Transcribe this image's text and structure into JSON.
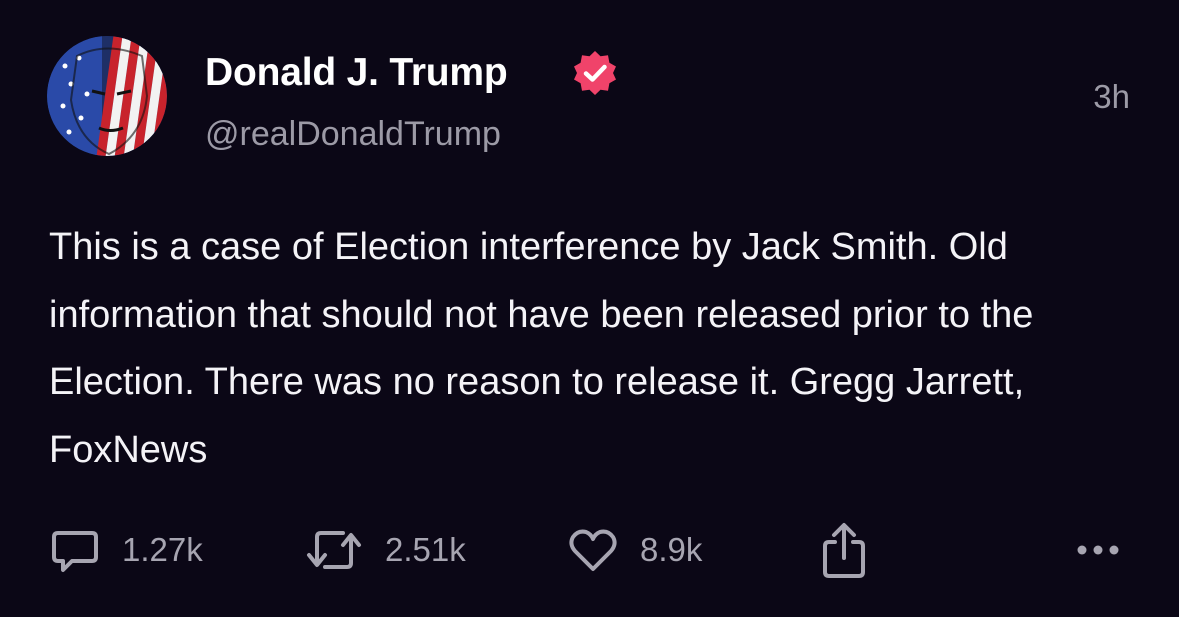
{
  "post": {
    "author": {
      "display_name": "Donald J. Trump",
      "handle": "@realDonaldTrump",
      "verified": true,
      "verified_badge_color": "#f0436a"
    },
    "timestamp": "3h",
    "text": "This is a case of Election interference by Jack Smith. Old information that should not have been released prior to the Election. There was no reason to release it. Gregg Jarrett, FoxNews",
    "stats": {
      "replies": "1.27k",
      "reposts": "2.51k",
      "likes": "8.9k"
    }
  },
  "icons": {
    "reply": "speech-bubble-icon",
    "repost": "repost-arrows-icon",
    "like": "heart-icon",
    "share": "share-upload-icon",
    "more": "more-dots-icon"
  },
  "colors": {
    "background": "#0b0716",
    "primary_text": "#ffffff",
    "secondary_text": "#9c9aa6",
    "verified": "#f0436a"
  }
}
